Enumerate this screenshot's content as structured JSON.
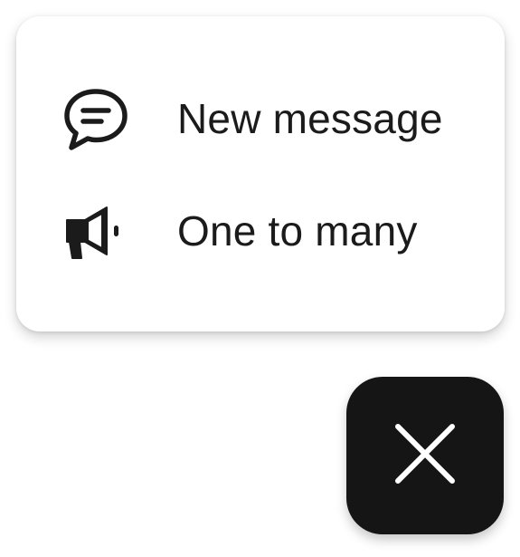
{
  "menu": {
    "items": [
      {
        "label": "New message",
        "icon": "chat-bubble-icon"
      },
      {
        "label": "One to many",
        "icon": "megaphone-icon"
      }
    ]
  },
  "fab": {
    "icon": "close-icon"
  }
}
